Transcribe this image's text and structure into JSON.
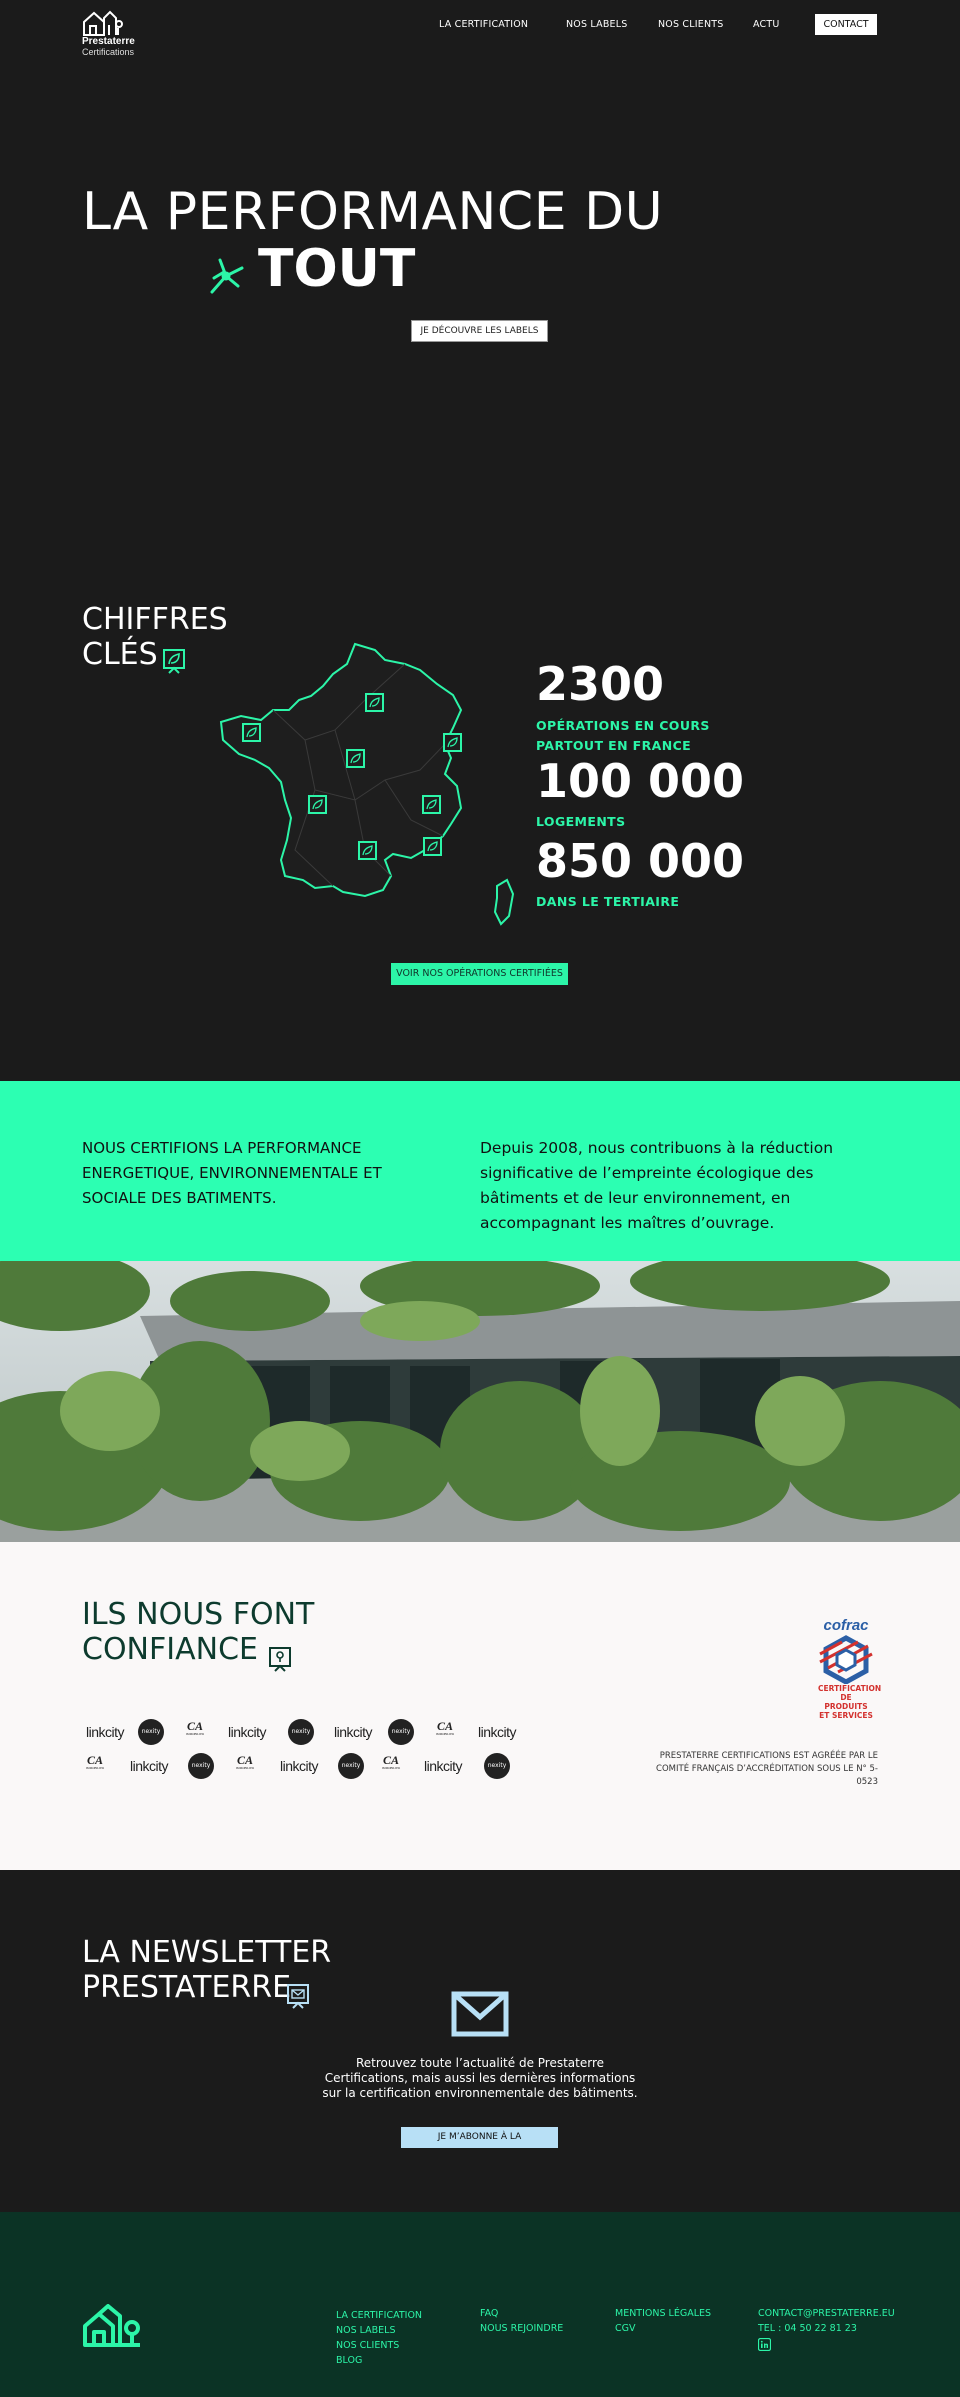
{
  "header": {
    "brand": "Prestaterre",
    "brand_sub": "Certifications",
    "nav": [
      "LA CERTIFICATION",
      "NOS LABELS",
      "NOS CLIENTS",
      "ACTU"
    ],
    "contact": "CONTACT"
  },
  "hero": {
    "title_line1": "LA PERFORMANCE DU",
    "title_line2": "TOUT",
    "cta": "JE DÉCOUVRE LES LABELS"
  },
  "chiffres": {
    "title_line1": "CHIFFRES",
    "title_line2": "CLÉS",
    "stats": [
      {
        "value": "2300",
        "label_line1": "OPÉRATIONS EN COURS",
        "label_line2": "PARTOUT EN FRANCE"
      },
      {
        "value": "100 000",
        "label_line1": "LOGEMENTS",
        "label_line2": ""
      },
      {
        "value": "850 000",
        "label_line1": "DANS LE TERTIAIRE",
        "label_line2": ""
      }
    ],
    "cta": "VOIR NOS OPÉRATIONS CERTIFIÉES"
  },
  "band": {
    "left": "NOUS CERTIFIONS LA PERFORMANCE ENERGETIQUE, ENVIRONNEMENTALE ET SOCIALE DES BATIMENTS.",
    "right": "Depuis 2008, nous contribuons à la réduction significative de l’empreinte écologique des bâtiments et de leur environnement, en accompagnant les maîtres d’ouvrage."
  },
  "confiance": {
    "title_line1": "ILS NOUS FONT",
    "title_line2": "CONFIANCE",
    "logos": {
      "linkcity": "linkcity",
      "nexity": "nexity",
      "ca": "CA",
      "ca_sub": "IMMOBILIER"
    },
    "cofrac": {
      "brand": "cofrac",
      "text1": "CERTIFICATION",
      "text2": "DE PRODUITS",
      "text3": "ET SERVICES"
    },
    "accreditation": "PRESTATERRE CERTIFICATIONS EST AGRÉÉE PAR LE COMITÉ FRANÇAIS D’ACCRÉDITATION SOUS LE N° 5-0523"
  },
  "newsletter": {
    "title_line1": "LA NEWSLETTER",
    "title_line2": "PRESTATERRE",
    "text": "Retrouvez toute l’actualité de Prestaterre Certifications, mais aussi les dernières informations sur la certification environnementale des bâtiments.",
    "cta": "JE M’ABONNE À LA"
  },
  "footer": {
    "col1": [
      "LA CERTIFICATION",
      "NOS LABELS",
      "NOS CLIENTS",
      "BLOG"
    ],
    "col2": [
      "FAQ",
      "NOUS REJOINDRE"
    ],
    "col3": [
      "MENTIONS LÉGALES",
      "CGV"
    ],
    "email": "CONTACT@PRESTATERRE.EU",
    "phone": "TEL : 04 50 22 81 23"
  },
  "colors": {
    "accent": "#2cf5a8",
    "dark": "#1b1b1b",
    "footer": "#0b3325",
    "newsletter_button": "#b8e0f6"
  }
}
